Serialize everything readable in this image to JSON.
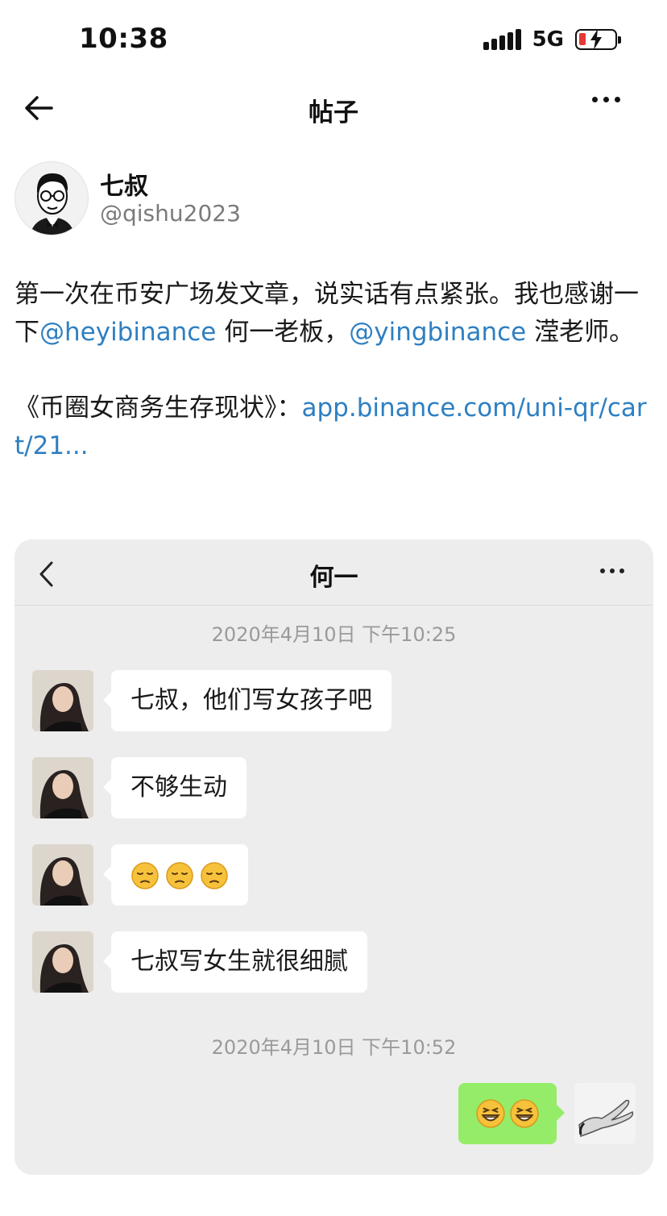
{
  "status_bar": {
    "time": "10:38",
    "network": "5G"
  },
  "header": {
    "title": "帖子"
  },
  "author": {
    "name": "七叔",
    "handle": "@qishu2023"
  },
  "post": {
    "text_1": "第一次在币安广场发文章，说实话有点紧张。我也感谢一下",
    "mention_1": "@heyibinance",
    "text_2": " 何一老板，",
    "mention_2": "@yingbinance",
    "text_3": " 滢老师。",
    "text_4": "《币圈女商务生存现状》：",
    "link": "app.binance.com/uni-qr/cart/21..."
  },
  "chat": {
    "title": "何一",
    "timestamp_1": "2020年4月10日 下午10:25",
    "messages": [
      {
        "text": "七叔，他们写女孩子吧"
      },
      {
        "text": "不够生动"
      },
      {
        "emoji": [
          "pensive-face",
          "pensive-face",
          "pensive-face"
        ]
      },
      {
        "text": "七叔写女生就很细腻"
      }
    ],
    "timestamp_2": "2020年4月10日 下午10:52",
    "reply_emoji": [
      "grinning-face",
      "grinning-face"
    ]
  },
  "colors": {
    "link": "#2e7fc2",
    "chat_bg": "#ededed",
    "self_bubble": "#95ec69",
    "battery_low": "#e53935"
  }
}
